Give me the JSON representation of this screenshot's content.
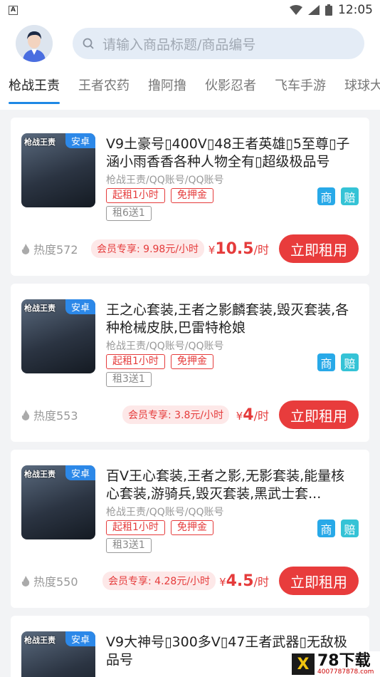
{
  "status": {
    "time": "12:05"
  },
  "search": {
    "placeholder": "请输入商品标题/商品编号"
  },
  "tabs": [
    "枪战王责",
    "王者农药",
    "撸阿撸",
    "伙影忍者",
    "飞车手游",
    "球球大"
  ],
  "products": [
    {
      "game_label": "枪战王责",
      "os": "安卓",
      "title": "V9土豪号▯400V▯48王者英雄▯5至尊▯子涵小雨香香各种人物全有▯超级极品号",
      "category": "枪战王责/QQ账号/QQ账号",
      "tag1": "起租1小时",
      "tag2": "免押金",
      "promo": "租6送1",
      "badge1": "商",
      "badge2": "赔",
      "heat": "热度572",
      "vip": "会员专享: 9.98元/小时",
      "price_symbol": "¥",
      "price": "10.5",
      "price_unit": "/时",
      "button": "立即租用"
    },
    {
      "game_label": "枪战王责",
      "os": "安卓",
      "title": "王之心套装,王者之影麟套装,毁灭套装,各种枪械皮肤,巴雷特枪娘",
      "category": "枪战王责/QQ账号/QQ账号",
      "tag1": "起租1小时",
      "tag2": "免押金",
      "promo": "租3送1",
      "badge1": "商",
      "badge2": "赔",
      "heat": "热度553",
      "vip": "会员专享: 3.8元/小时",
      "price_symbol": "¥",
      "price": "4",
      "price_unit": "/时",
      "button": "立即租用"
    },
    {
      "game_label": "枪战王责",
      "os": "安卓",
      "title": "百V王心套装,王者之影,无影套装,能量核心套装,游骑兵,毁灭套装,黑武士套...",
      "category": "枪战王责/QQ账号/QQ账号",
      "tag1": "起租1小时",
      "tag2": "免押金",
      "promo": "租3送1",
      "badge1": "商",
      "badge2": "赔",
      "heat": "热度550",
      "vip": "会员专享: 4.28元/小时",
      "price_symbol": "¥",
      "price": "4.5",
      "price_unit": "/时",
      "button": "立即租用"
    },
    {
      "game_label": "枪战王责",
      "os": "安卓",
      "title": "V9大神号▯300多V▯47王者武器▯无敌极品号"
    }
  ],
  "watermark": {
    "logo": "X",
    "text": "78下载",
    "url": "4007787878.com"
  }
}
